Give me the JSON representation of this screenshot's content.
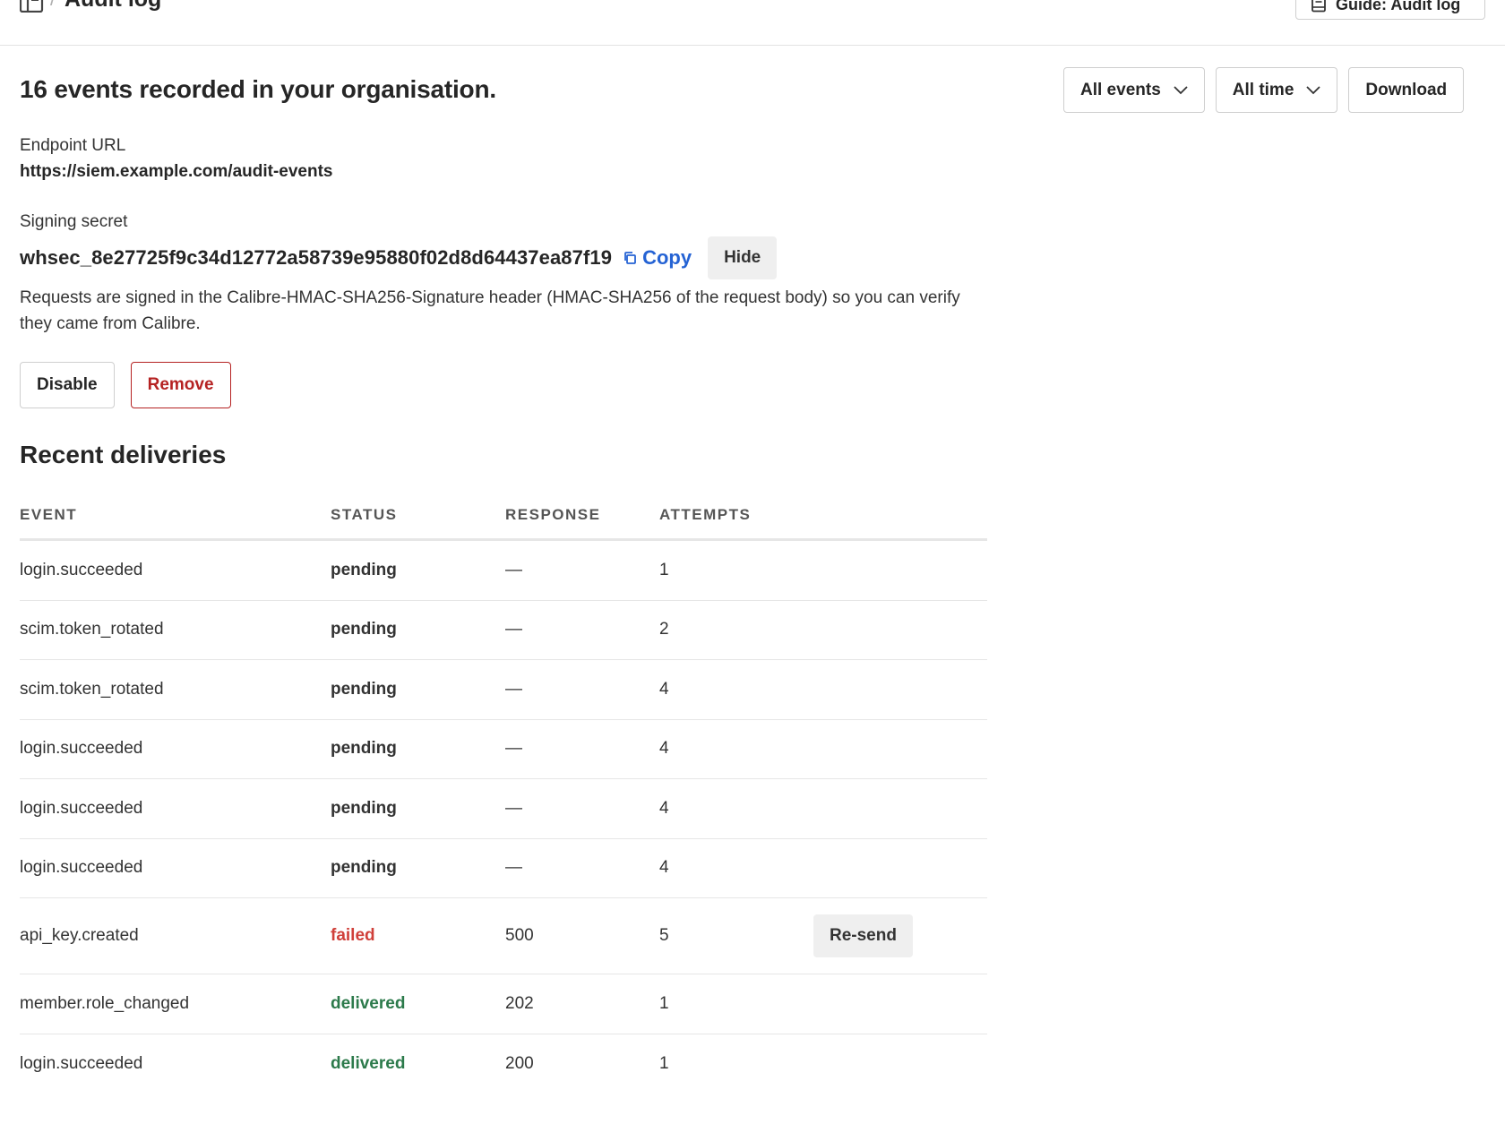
{
  "header": {
    "title": "Audit log",
    "separator": "/",
    "guide_label": "Guide: Audit log"
  },
  "summary": "16 events recorded in your organisation.",
  "filters": {
    "events_label": "All events",
    "time_label": "All time",
    "download_label": "Download"
  },
  "endpoint": {
    "label": "Endpoint URL",
    "value": "https://siem.example.com/audit-events"
  },
  "secret": {
    "label": "Signing secret",
    "value": "whsec_8e27725f9c34d12772a58739e95880f02d8d64437ea87f19",
    "copy_label": "Copy",
    "hide_label": "Hide",
    "description": "Requests are signed in the Calibre-HMAC-SHA256-Signature header (HMAC-SHA256 of the request body) so you can verify they came from Calibre."
  },
  "actions": {
    "disable_label": "Disable",
    "remove_label": "Remove"
  },
  "deliveries": {
    "title": "Recent deliveries",
    "columns": [
      "EVENT",
      "STATUS",
      "RESPONSE",
      "ATTEMPTS"
    ],
    "resend_label": "Re-send",
    "rows": [
      {
        "event": "login.succeeded",
        "status": "pending",
        "response": "—",
        "attempts": "1"
      },
      {
        "event": "scim.token_rotated",
        "status": "pending",
        "response": "—",
        "attempts": "2"
      },
      {
        "event": "scim.token_rotated",
        "status": "pending",
        "response": "—",
        "attempts": "4"
      },
      {
        "event": "login.succeeded",
        "status": "pending",
        "response": "—",
        "attempts": "4"
      },
      {
        "event": "login.succeeded",
        "status": "pending",
        "response": "—",
        "attempts": "4"
      },
      {
        "event": "login.succeeded",
        "status": "pending",
        "response": "—",
        "attempts": "4"
      },
      {
        "event": "api_key.created",
        "status": "failed",
        "response": "500",
        "attempts": "5"
      },
      {
        "event": "member.role_changed",
        "status": "delivered",
        "response": "202",
        "attempts": "1"
      },
      {
        "event": "login.succeeded",
        "status": "delivered",
        "response": "200",
        "attempts": "1"
      }
    ]
  }
}
